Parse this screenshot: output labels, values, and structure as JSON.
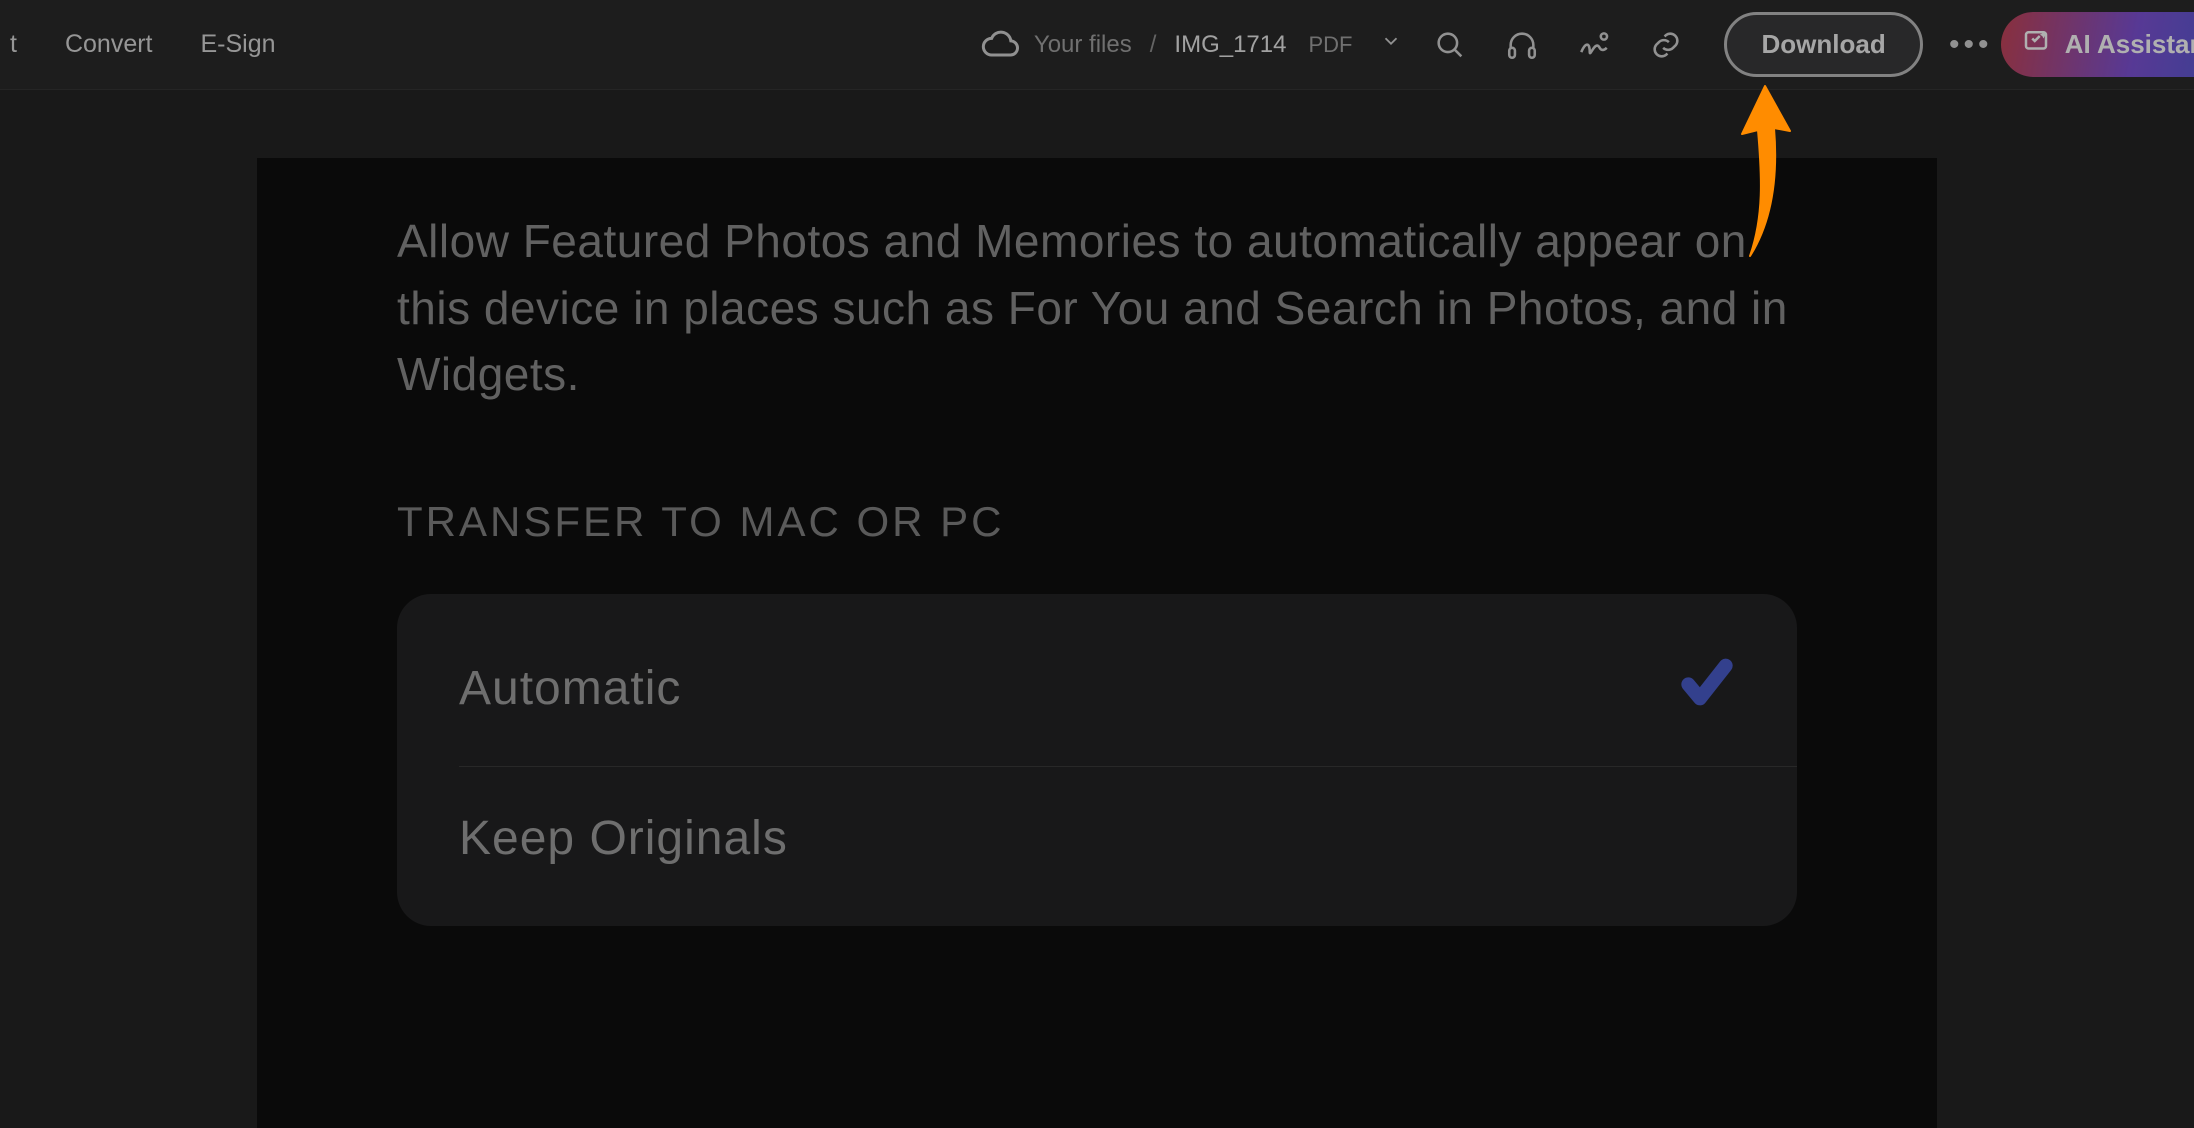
{
  "topbar": {
    "convert_label": "Convert",
    "esign_label": "E-Sign",
    "cut_label": "t",
    "breadcrumb_root": "Your files",
    "breadcrumb_sep": "/",
    "filename": "IMG_1714",
    "file_ext": "PDF",
    "download_label": "Download",
    "more_label": "•••",
    "ai_label": "AI Assistant"
  },
  "document": {
    "description": "Allow Featured Photos and Memories to automatically appear on this device in places such as For You and Search in Photos, and in Widgets.",
    "section_title": "TRANSFER TO MAC OR PC",
    "options": [
      {
        "label": "Automatic",
        "selected": true
      },
      {
        "label": "Keep Originals",
        "selected": false
      }
    ]
  },
  "icons": {
    "cloud": "cloud-icon",
    "search": "search-icon",
    "headphones": "headphones-icon",
    "signature": "signature-icon",
    "link": "link-icon",
    "chevron_down": "chevron-down-icon",
    "check": "check-icon",
    "ai": "ai-sparkle-icon"
  }
}
